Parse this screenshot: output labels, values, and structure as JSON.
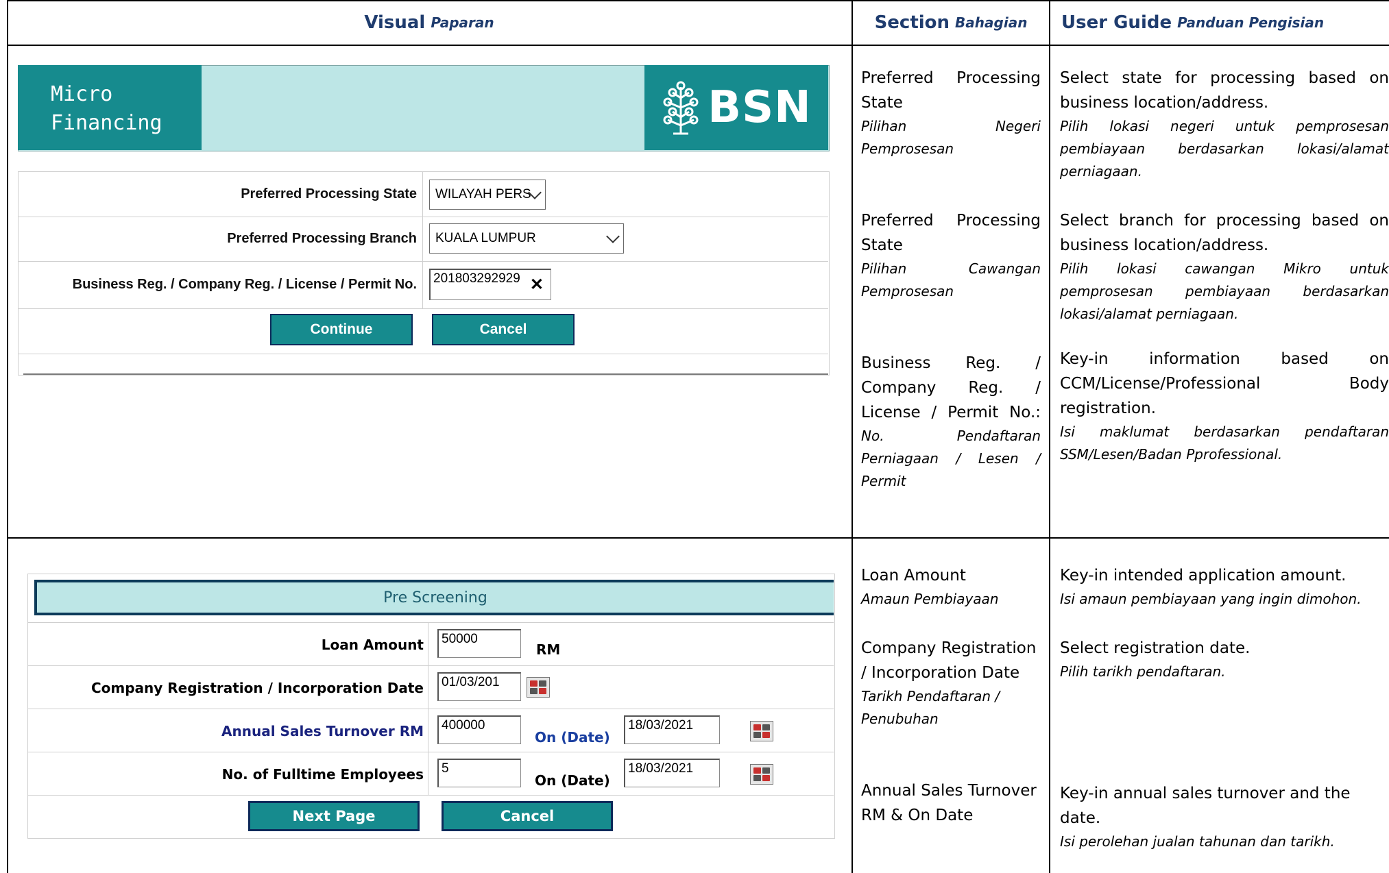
{
  "header": {
    "visual": "Visual",
    "visual_it": "Paparan",
    "section": "Section",
    "section_it": "Bahagian",
    "guide": "User Guide",
    "guide_it": "Panduan Pengisian"
  },
  "visual1": {
    "banner_title_1": "Micro",
    "banner_title_2": "Financing",
    "logo_text": "BSN",
    "state_label": "Preferred Processing State",
    "state_value": "WILAYAH PERS",
    "branch_label": "Preferred Processing Branch",
    "branch_value": "KUALA LUMPUR",
    "reg_label": "Business Reg. / Company Reg. / License / Permit No.",
    "reg_value": "201803292929",
    "clear_icon": "✕",
    "continue_label": "Continue",
    "cancel_label": "Cancel"
  },
  "visual2": {
    "title": "Pre Screening",
    "loan_label": "Loan Amount",
    "loan_value": "50000",
    "loan_unit": "RM",
    "reg_date_label": "Company Registration / Incorporation Date",
    "reg_date_value": "01/03/201",
    "turnover_label": "Annual Sales Turnover RM",
    "turnover_value": "400000",
    "on_date_label": "On (Date)",
    "turnover_date": "18/03/2021",
    "employees_label": "No. of Fulltime Employees",
    "employees_value": "5",
    "employees_date": "18/03/2021",
    "next_label": "Next Page",
    "cancel_label": "Cancel"
  },
  "sections": {
    "s1_name": "Preferred Processing State",
    "s1_it": "Pilihan Negeri Pemprosesan",
    "s2_name": "Preferred Processing State",
    "s2_it": "Pilihan Cawangan Pemprosesan",
    "s3_name": "Business Reg. / Company Reg. / License / Permit No.:",
    "s3_it": "No. Pendaftaran Perniagaan / Lesen / Permit",
    "s4_name": "Loan Amount",
    "s4_it": "Amaun Pembiayaan",
    "s5_name": "Company Registration / Incorporation Date",
    "s5_it": "Tarikh Pendaftaran / Penubuhan",
    "s6_name": "Annual Sales Turnover RM & On Date"
  },
  "guides": {
    "g1": "Select state for processing based on business location/address.",
    "g1_it": "Pilih lokasi negeri untuk pemprosesan pembiayaan berdasarkan lokasi/alamat perniagaan.",
    "g2": "Select branch for processing based on business location/address.",
    "g2_it": "Pilih lokasi cawangan Mikro untuk pemprosesan pembiayaan berdasarkan lokasi/alamat perniagaan.",
    "g3": "Key-in information based on CCM/License/Professional Body registration.",
    "g3_it": "Isi maklumat berdasarkan pendaftaran SSM/Lesen/Badan Pprofessional.",
    "g4": "Key-in intended application amount.",
    "g4_it": "Isi amaun pembiayaan yang ingin dimohon.",
    "g5": "Select registration date.",
    "g5_it": "Pilih tarikh pendaftaran.",
    "g6": "Key-in annual sales turnover and the date.",
    "g6_it": "Isi perolehan jualan tahunan dan tarikh."
  },
  "colors": {
    "teal": "#168b8e",
    "light_teal": "#bde6e6",
    "navy_header": "#1f3c6e",
    "turnover_blue": "#1a237e"
  }
}
